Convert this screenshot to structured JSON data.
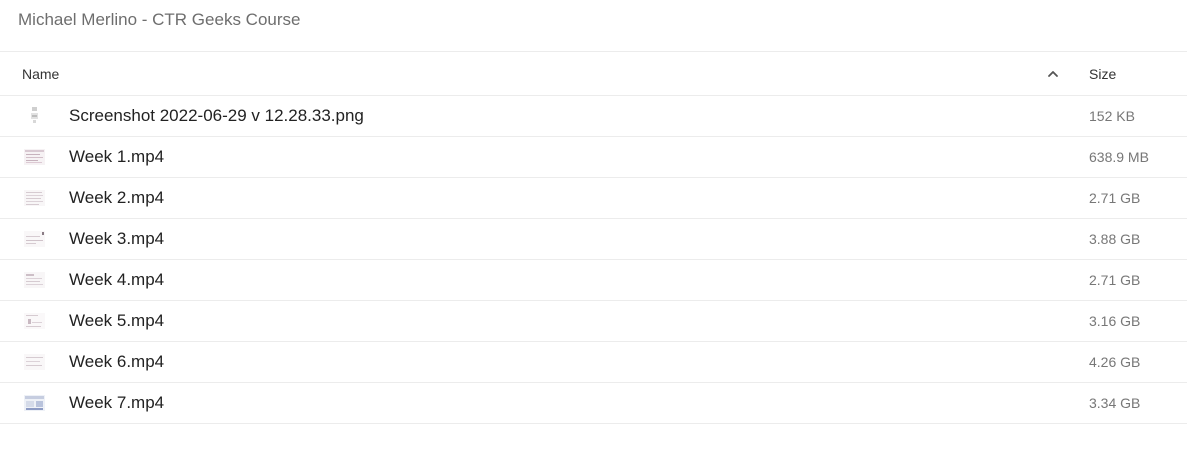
{
  "breadcrumb": {
    "title": "Michael Merlino - CTR Geeks Course"
  },
  "table": {
    "columns": {
      "name": "Name",
      "size": "Size"
    },
    "sort": {
      "column": "name",
      "direction": "ascending",
      "icon": "chevron-up-icon"
    },
    "rows": [
      {
        "name": "Screenshot 2022-06-29 v 12.28.33.png",
        "size": "152 KB",
        "thumbnail": "image-thumbnail"
      },
      {
        "name": "Week 1.mp4",
        "size": "638.9 MB",
        "thumbnail": "video-thumbnail"
      },
      {
        "name": "Week 2.mp4",
        "size": "2.71 GB",
        "thumbnail": "video-thumbnail"
      },
      {
        "name": "Week 3.mp4",
        "size": "3.88 GB",
        "thumbnail": "video-thumbnail"
      },
      {
        "name": "Week 4.mp4",
        "size": "2.71 GB",
        "thumbnail": "video-thumbnail"
      },
      {
        "name": "Week 5.mp4",
        "size": "3.16 GB",
        "thumbnail": "video-thumbnail"
      },
      {
        "name": "Week 6.mp4",
        "size": "4.26 GB",
        "thumbnail": "video-thumbnail"
      },
      {
        "name": "Week 7.mp4",
        "size": "3.34 GB",
        "thumbnail": "video-thumbnail"
      }
    ]
  }
}
